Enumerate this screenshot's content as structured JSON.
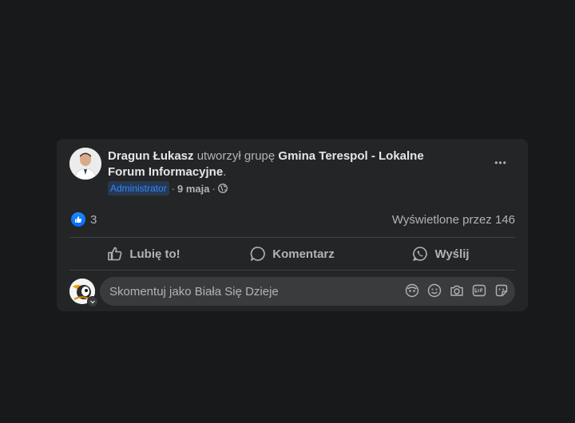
{
  "post": {
    "author": "Dragun Łukasz",
    "action_text": " utworzył grupę ",
    "group_name": "Gmina Terespol - Lokalne Forum Informacyjne",
    "end_punct": ".",
    "role_badge": "Administrator",
    "separator": "·",
    "date": "9 maja",
    "privacy_icon": "globe-icon",
    "more_icon": "more-horizontal-icon",
    "more_label": "•••"
  },
  "stats": {
    "reaction_icon": "like-reaction-icon",
    "reaction_count": "3",
    "views": "Wyświetlone przez 146"
  },
  "actions": {
    "like_label": "Lubię to!",
    "comment_label": "Komentarz",
    "send_label": "Wyślij"
  },
  "comment": {
    "placeholder": "Skomentuj jako Biała Się Dzieje",
    "icons": [
      "avatar-sticker-icon",
      "emoji-icon",
      "camera-icon",
      "gif-icon",
      "sticker-icon"
    ]
  },
  "colors": {
    "background": "#18191a",
    "card": "#242526",
    "accent": "#2d88ff",
    "text_primary": "#e4e6eb",
    "text_secondary": "#b0b3b8"
  }
}
